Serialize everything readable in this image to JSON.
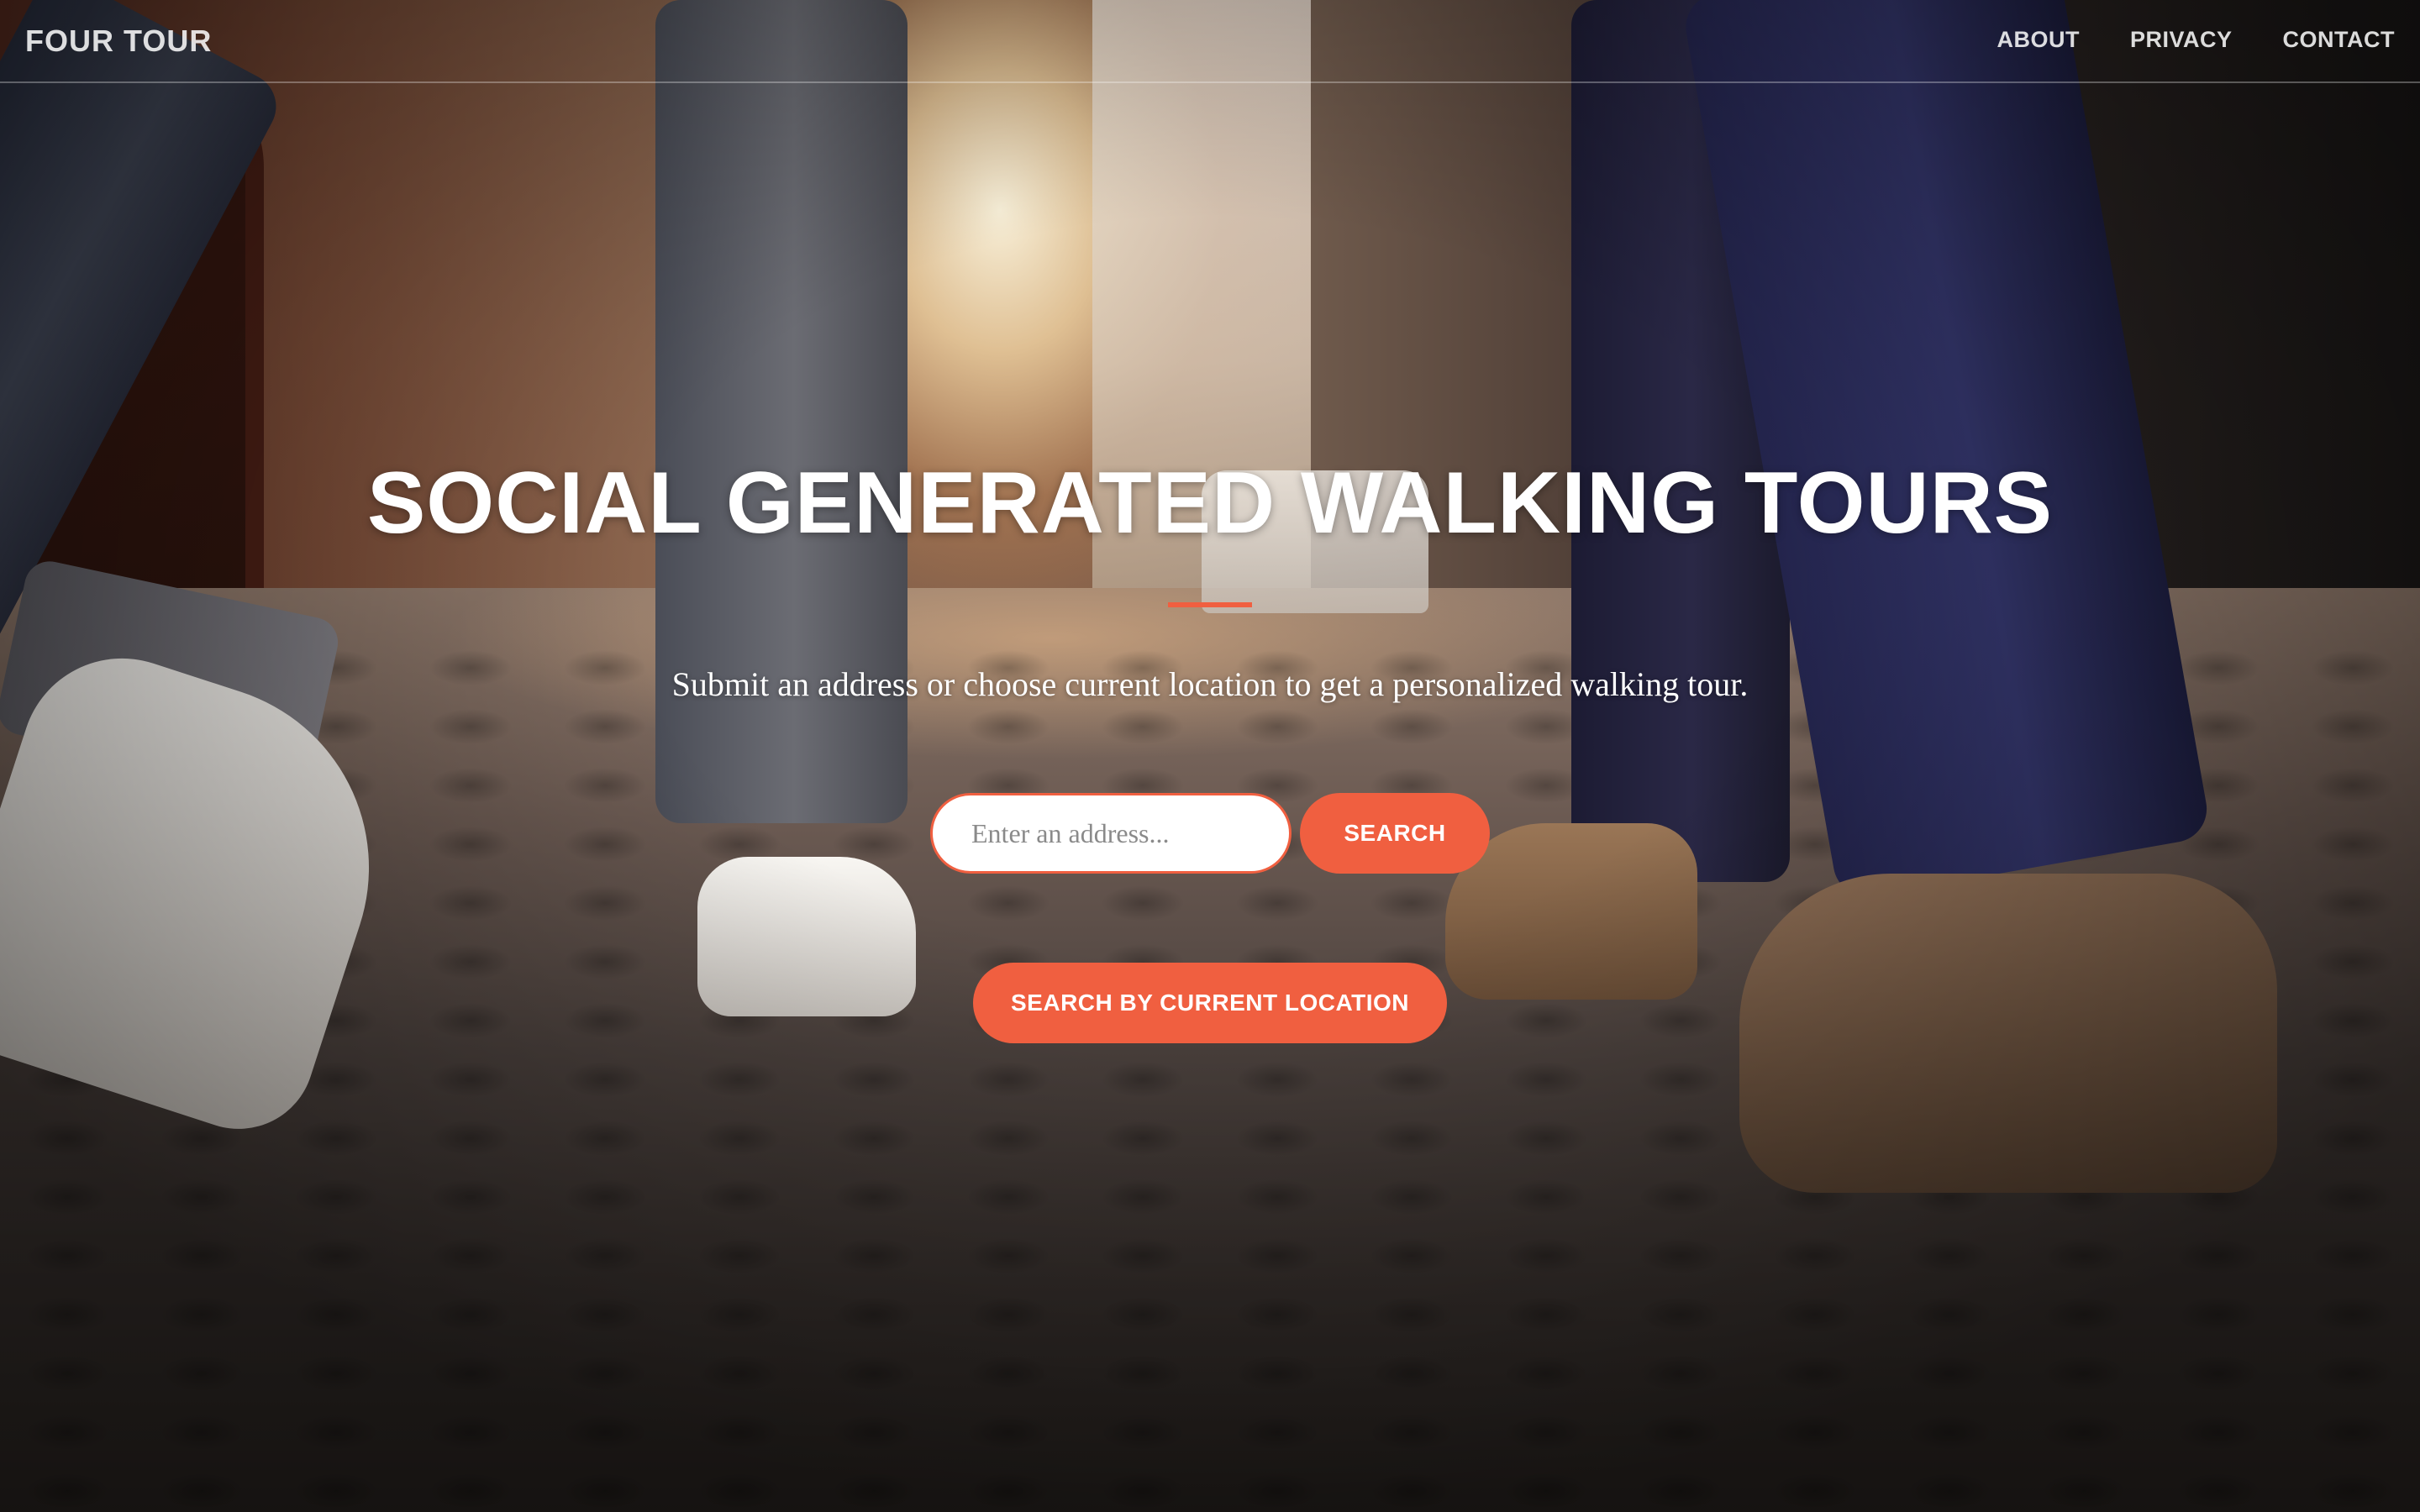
{
  "navbar": {
    "brand": "FOUR TOUR",
    "links": [
      {
        "label": "ABOUT"
      },
      {
        "label": "PRIVACY"
      },
      {
        "label": "CONTACT"
      }
    ]
  },
  "hero": {
    "title": "SOCIAL GENERATED WALKING TOURS",
    "subtitle": "Submit an address or choose current location to get a personalized walking tour.",
    "search": {
      "placeholder": "Enter an address...",
      "value": "",
      "button_label": "SEARCH"
    },
    "location_button_label": "SEARCH BY CURRENT LOCATION"
  },
  "colors": {
    "accent": "#f05f40",
    "text_light": "#ffffff"
  },
  "icons": []
}
